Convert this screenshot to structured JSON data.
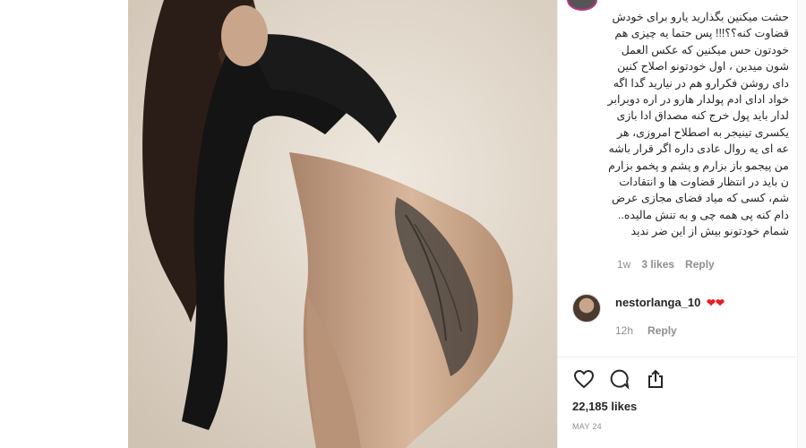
{
  "post": {
    "image_alt": "Instagram post photo",
    "colors": {
      "background": "#e6ddd2",
      "accent_red": "#ed1c24",
      "muted": "#8e8e8e",
      "text": "#262626"
    }
  },
  "comment": {
    "text": "حشت میکنین بگذارید یارو برای خودش\nقضاوت کنه؟؟!!! پس حتما یه چیزی هم\nخودتون حس میکنین که عکس العمل\nشون میدین ، اول خودتونو اصلاح کنین\nدای روشن فکرارو هم در نیارید گدا اگه\nخواد ادای ادم پولدار هارو در اره دوبرابر\nلدار باید پول خرج کنه مصداق ادا بازی\nیکسری تینیجر به اصطلاح امروزی، هر\nعه ای یه روال عادی داره اگر قرار باشه\nمن پیجمو باز بزارم و پشم و پخمو بزارم\nن باید در انتظار قضاوت ها و انتقادات\nشم، کسی که میاد فضای مجازی عرض\nدام کنه پی همه چی و به تنش مالیده..\nشمام خودتونو بیش از این ضر ندید",
    "time": "1w",
    "likes": "3 likes",
    "reply_label": "Reply"
  },
  "reply": {
    "username": "nestorlanga_10",
    "hearts": "❤❤",
    "time": "12h",
    "reply_label": "Reply",
    "avatar_icon": "user-avatar"
  },
  "actions": {
    "like_icon": "heart-outline-icon",
    "comment_icon": "comment-icon",
    "share_icon": "share-icon"
  },
  "stats": {
    "likes": "22,185 likes",
    "date": "MAY 24"
  }
}
